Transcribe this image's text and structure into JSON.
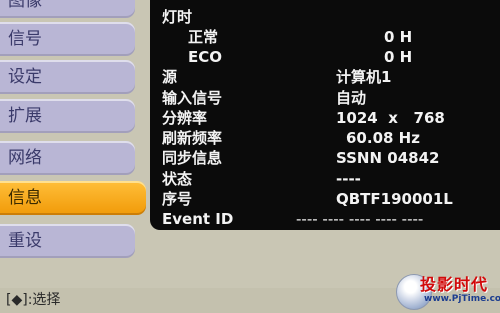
{
  "menu": [
    {
      "label": "图像",
      "active": false
    },
    {
      "label": "信号",
      "active": false
    },
    {
      "label": "设定",
      "active": false
    },
    {
      "label": "扩展",
      "active": false
    },
    {
      "label": "网络",
      "active": false
    },
    {
      "label": "信息",
      "active": true
    },
    {
      "label": "重设",
      "active": false
    }
  ],
  "info": {
    "lamp_hours_label": "灯时",
    "normal_label": "正常",
    "normal_value": "0 H",
    "eco_label": "ECO",
    "eco_value": "0 H",
    "source_label": "源",
    "source_value": "计算机1",
    "input_signal_label": "输入信号",
    "input_signal_value": "自动",
    "resolution_label": "分辨率",
    "resolution_value": "1024  x   768",
    "refresh_label": "刷新频率",
    "refresh_value": "60.08 Hz",
    "sync_label": "同步信息",
    "sync_value": "SSNN 04842",
    "status_label": "状态",
    "status_value": "----",
    "serial_label": "序号",
    "serial_value": "QBTF190001L",
    "event_id_label": "Event ID",
    "event_id_value": "---- ---- ---- ---- ----"
  },
  "bottom_bar": {
    "hint": "[◆]:选择"
  },
  "watermark": {
    "title": "投影时代",
    "url": "www.PjTime.com"
  },
  "colors": {
    "panel_bg": "#0b0b0b",
    "menu_bg": "#b9b6d5",
    "menu_active": "#f5a623",
    "screen_bg": "#c9c6b4"
  }
}
